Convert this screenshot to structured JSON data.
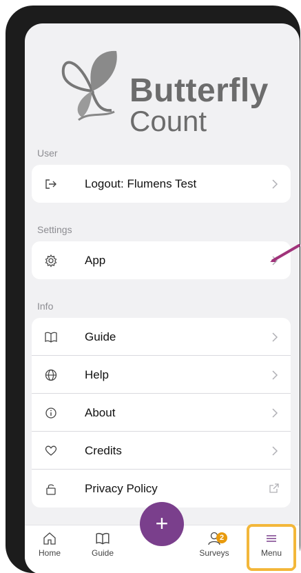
{
  "logo": {
    "line1": "Butterfly",
    "line2": "Count"
  },
  "sections": {
    "user": {
      "label": "User",
      "items": [
        {
          "label": "Logout: Flumens Test",
          "icon": "logout-icon"
        }
      ]
    },
    "settings": {
      "label": "Settings",
      "items": [
        {
          "label": "App",
          "icon": "gear-icon"
        }
      ]
    },
    "info": {
      "label": "Info",
      "items": [
        {
          "label": "Guide",
          "icon": "book-icon"
        },
        {
          "label": "Help",
          "icon": "globe-icon"
        },
        {
          "label": "About",
          "icon": "info-icon"
        },
        {
          "label": "Credits",
          "icon": "heart-icon"
        },
        {
          "label": "Privacy Policy",
          "icon": "lock-icon"
        }
      ]
    }
  },
  "tabbar": {
    "home": "Home",
    "guide": "Guide",
    "add": "+",
    "surveys": "Surveys",
    "surveys_badge": "2",
    "menu": "Menu"
  },
  "colors": {
    "accent": "#7a3f8c",
    "badge": "#e89a0d",
    "highlight": "#f3b73a",
    "annotation_arrow": "#a0337a"
  }
}
